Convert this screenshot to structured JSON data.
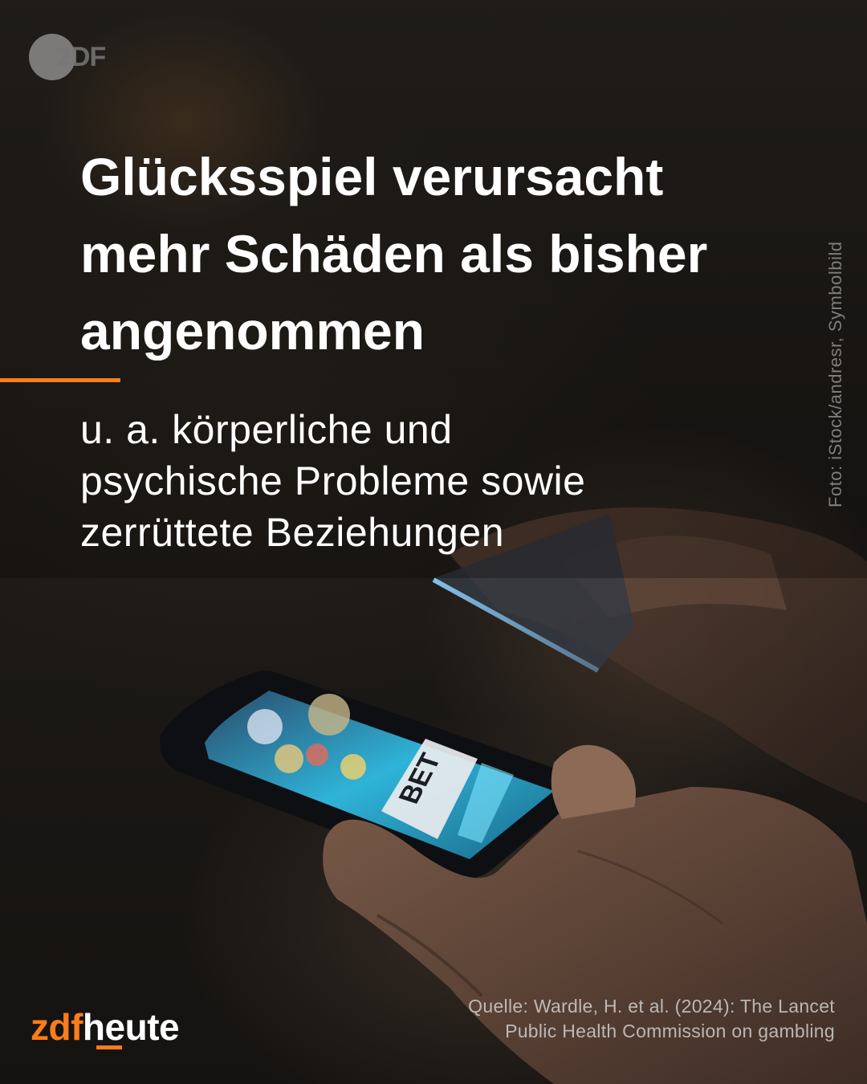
{
  "brand": {
    "badge_text": "2DF",
    "logo_part1": "zdf",
    "logo_part2": "heute",
    "accent_color": "#fa7d19"
  },
  "headline": {
    "lines": [
      "Glücksspiel verursacht",
      "mehr Schäden als bisher",
      "angenommen"
    ]
  },
  "subline": {
    "lines": [
      "u. a. körperliche und",
      "psychische Probleme sowie",
      "zerrüttete Beziehungen"
    ]
  },
  "photo": {
    "credit": "Foto: iStock/andresr, Symbolbild",
    "screen_text": "BET"
  },
  "source": {
    "lines": [
      "Quelle: Wardle, H. et al. (2024): The Lancet",
      "Public Health Commission on gambling"
    ]
  }
}
